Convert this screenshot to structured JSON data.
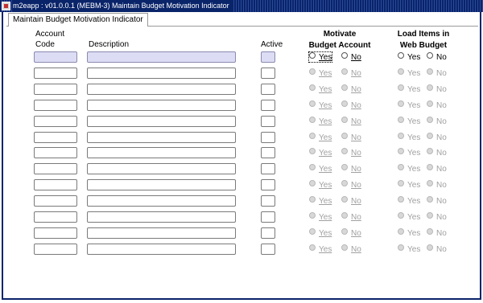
{
  "window": {
    "title": "m2eapp : v01.0.0.1 (MEBM-3) Maintain Budget Motivation Indicator"
  },
  "tab": {
    "label": "Maintain Budget Motivation Indicator"
  },
  "headers": {
    "account_line1": "Account",
    "account_line2": "Code",
    "description": "Description",
    "active": "Active",
    "motivate_line1": "Motivate",
    "motivate_line2": "Budget Account",
    "load_line1": "Load Items in",
    "load_line2": "Web Budget"
  },
  "radio_labels": {
    "yes": "Yes",
    "no": "No"
  },
  "rows": [
    {
      "code": "",
      "description": "",
      "active": false,
      "motivate": "",
      "web_budget": "",
      "enabled": true
    },
    {
      "code": "",
      "description": "",
      "active": false,
      "motivate": "",
      "web_budget": "",
      "enabled": false
    },
    {
      "code": "",
      "description": "",
      "active": false,
      "motivate": "",
      "web_budget": "",
      "enabled": false
    },
    {
      "code": "",
      "description": "",
      "active": false,
      "motivate": "",
      "web_budget": "",
      "enabled": false
    },
    {
      "code": "",
      "description": "",
      "active": false,
      "motivate": "",
      "web_budget": "",
      "enabled": false
    },
    {
      "code": "",
      "description": "",
      "active": false,
      "motivate": "",
      "web_budget": "",
      "enabled": false
    },
    {
      "code": "",
      "description": "",
      "active": false,
      "motivate": "",
      "web_budget": "",
      "enabled": false
    },
    {
      "code": "",
      "description": "",
      "active": false,
      "motivate": "",
      "web_budget": "",
      "enabled": false
    },
    {
      "code": "",
      "description": "",
      "active": false,
      "motivate": "",
      "web_budget": "",
      "enabled": false
    },
    {
      "code": "",
      "description": "",
      "active": false,
      "motivate": "",
      "web_budget": "",
      "enabled": false
    },
    {
      "code": "",
      "description": "",
      "active": false,
      "motivate": "",
      "web_budget": "",
      "enabled": false
    },
    {
      "code": "",
      "description": "",
      "active": false,
      "motivate": "",
      "web_budget": "",
      "enabled": false
    },
    {
      "code": "",
      "description": "",
      "active": false,
      "motivate": "",
      "web_budget": "",
      "enabled": false
    }
  ],
  "colors": {
    "titlebar": "#0a246a",
    "active_field": "#dcdcf4",
    "disabled_text": "#a0a0a0"
  }
}
